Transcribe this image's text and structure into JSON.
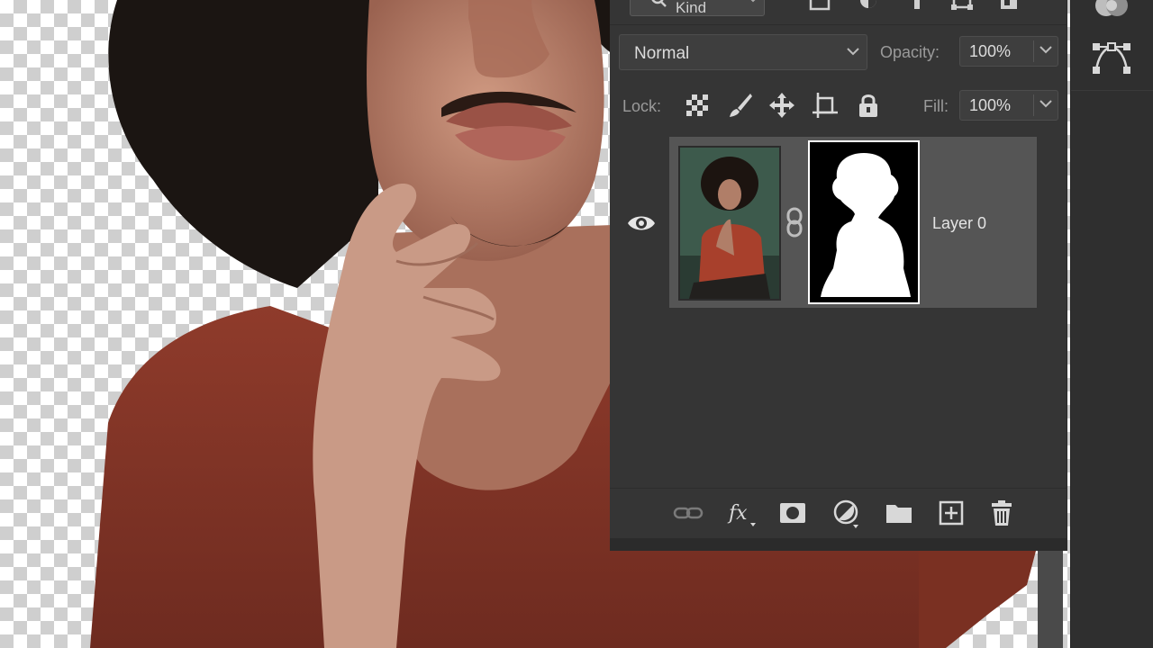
{
  "app": "Adobe Photoshop",
  "layers_panel": {
    "filter": {
      "kind_label": "Kind",
      "icons": [
        "search-icon",
        "pixel-filter-icon",
        "adjustment-filter-icon",
        "type-filter-icon",
        "shape-filter-icon",
        "smart-object-filter-icon"
      ]
    },
    "blend_mode": "Normal",
    "opacity_label": "Opacity:",
    "opacity_value": "100%",
    "lock_label": "Lock:",
    "lock_icons": [
      "lock-transparent-pixels-icon",
      "lock-image-pixels-icon",
      "lock-position-icon",
      "lock-artboard-icon",
      "lock-all-icon"
    ],
    "fill_label": "Fill:",
    "fill_value": "100%",
    "layers": [
      {
        "name": "Layer 0",
        "visible": true,
        "has_mask": true,
        "selected": true
      }
    ],
    "footer_icons": [
      "link-layers-icon",
      "fx-icon",
      "add-mask-icon",
      "adjustment-layer-icon",
      "group-folder-icon",
      "new-layer-icon",
      "trash-icon"
    ]
  },
  "colors": {
    "panel_bg": "#353535",
    "selected_layer_bg": "#555555",
    "shirt": "#8c3a2a",
    "skin": "#c08a72",
    "hair": "#1a1412"
  }
}
